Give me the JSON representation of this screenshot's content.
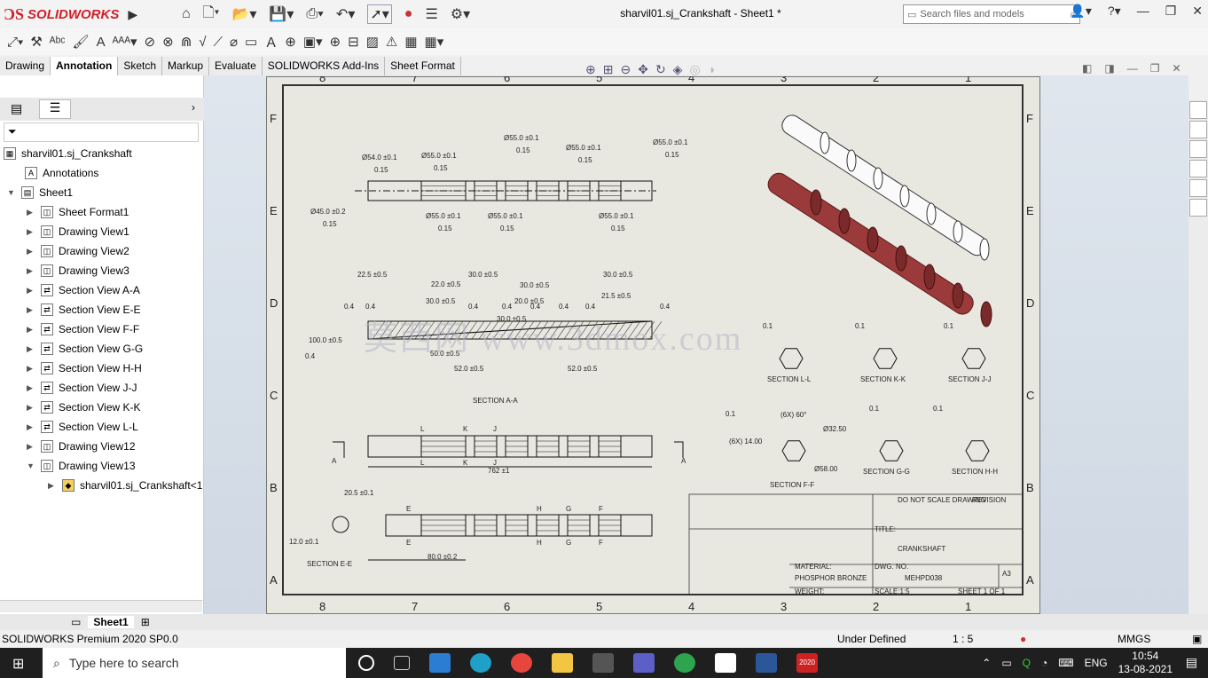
{
  "app": {
    "brand": "SOLIDWORKS",
    "title": "sharvil01.sj_Crankshaft - Sheet1 *",
    "search_placeholder": "Search files and models"
  },
  "tabs": [
    "Drawing",
    "Annotation",
    "Sketch",
    "Markup",
    "Evaluate",
    "SOLIDWORKS Add-Ins",
    "Sheet Format"
  ],
  "active_tab": "Annotation",
  "tree": {
    "root": "sharvil01.sj_Crankshaft",
    "annotations": "Annotations",
    "sheet": "Sheet1",
    "items": [
      "Sheet Format1",
      "Drawing View1",
      "Drawing View2",
      "Drawing View3",
      "Section View A-A",
      "Section View E-E",
      "Section View F-F",
      "Section View G-G",
      "Section View H-H",
      "Section View J-J",
      "Section View K-K",
      "Section View L-L",
      "Drawing View12",
      "Drawing View13"
    ],
    "child": "sharvil01.sj_Crankshaft<1"
  },
  "drawing": {
    "zones_cols": [
      "8",
      "7",
      "6",
      "5",
      "4",
      "3",
      "2",
      "1"
    ],
    "zones_rows": [
      "F",
      "E",
      "D",
      "C",
      "B",
      "A"
    ],
    "dims_top": [
      "Ø54.0 ±0.1",
      "Ø55.0 ±0.1",
      "Ø55.0 ±0.1",
      "Ø55.0 ±0.1",
      "Ø55.0 ±0.1",
      "Ø45.0 ±0.2",
      "Ø55.0 ±0.1",
      "Ø55.0 ±0.1",
      "Ø55.0 ±0.1"
    ],
    "tol": "0.15",
    "dims_mid": [
      "22.5 ±0.5",
      "30.0 ±0.5",
      "22.0 ±0.5",
      "30.0 ±0.5",
      "30.0 ±0.5",
      "21.5 ±0.5",
      "30.0 ±0.5",
      "20.0 ±0.5",
      "30.0 ±0.5",
      "52.0 ±0.5",
      "52.0 ±0.5",
      "100.0 ±0.5",
      "50.0 ±0.5"
    ],
    "surface": "0.4",
    "section_labels": [
      "SECTION A-A",
      "SECTION L-L",
      "SECTION K-K",
      "SECTION J-J",
      "SECTION F-F",
      "SECTION G-G",
      "SECTION H-H",
      "SECTION E-E"
    ],
    "profile_tol": "0.1",
    "ff_dims": [
      "(6X) 60°",
      "(6X) 14.00",
      "Ø32.50",
      "Ø58.00"
    ],
    "overall": "762 ±1",
    "ee_dims": [
      "20.5 ±0.1",
      "12.0 ±0.1",
      "80.0 ±0.2"
    ],
    "letters_top": [
      "L",
      "K",
      "J",
      "L",
      "K",
      "J"
    ],
    "letters_bottom": [
      "E",
      "H",
      "G",
      "F",
      "E",
      "H",
      "G",
      "F"
    ],
    "title_block": {
      "name": "CRANKSHAFT",
      "material": "PHOSPHOR BRONZE",
      "dwg_no": "MEHPD038",
      "size": "A3",
      "title_label": "TITLE:",
      "dwg_label": "DWG. NO.",
      "scale_label": "SCALE:1:5",
      "sheet_label": "SHEET 1 OF 1",
      "weight_label": "WEIGHT:",
      "material_label": "MATERIAL:",
      "no_scale": "DO NOT SCALE DRAWING",
      "revision": "REVISION"
    },
    "watermark": "莫西网 www.3dmox.com"
  },
  "bottom": {
    "sheet_tab": "Sheet1"
  },
  "status": {
    "product": "SOLIDWORKS Premium 2020 SP0.0",
    "state": "Under Defined",
    "scale": "1 : 5",
    "units": "MMGS"
  },
  "taskbar": {
    "search": "Type here to search",
    "lang": "ENG",
    "time": "10:54",
    "date": "13-08-2021",
    "sw_badge": "2020"
  },
  "colors": {
    "accent": "#d0202a",
    "part": "#9b3a3a"
  }
}
